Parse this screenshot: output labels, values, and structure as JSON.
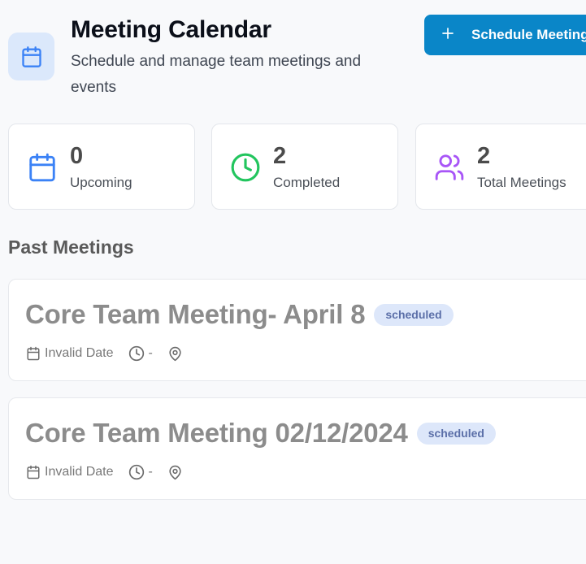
{
  "header": {
    "title": "Meeting Calendar",
    "subtitle": "Schedule and manage team meetings and events",
    "schedule_button_label": "Schedule Meeting",
    "icon": "calendar-icon"
  },
  "stats": [
    {
      "value": "0",
      "label": "Upcoming",
      "icon": "calendar-icon",
      "color": "#3b82f6"
    },
    {
      "value": "2",
      "label": "Completed",
      "icon": "clock-icon",
      "color": "#22c55e"
    },
    {
      "value": "2",
      "label": "Total Meetings",
      "icon": "users-icon",
      "color": "#a855f7"
    }
  ],
  "past_meetings": {
    "section_title": "Past Meetings",
    "items": [
      {
        "title": "Core Team Meeting- April 8",
        "status": "scheduled",
        "date": "Invalid Date",
        "time": "-",
        "location": ""
      },
      {
        "title": "Core Team Meeting 02/12/2024",
        "status": "scheduled",
        "date": "Invalid Date",
        "time": "-",
        "location": ""
      }
    ]
  },
  "colors": {
    "primary_button": "#0a86c8",
    "badge_bg": "#dde7fa",
    "badge_text": "#5b6fa8"
  }
}
